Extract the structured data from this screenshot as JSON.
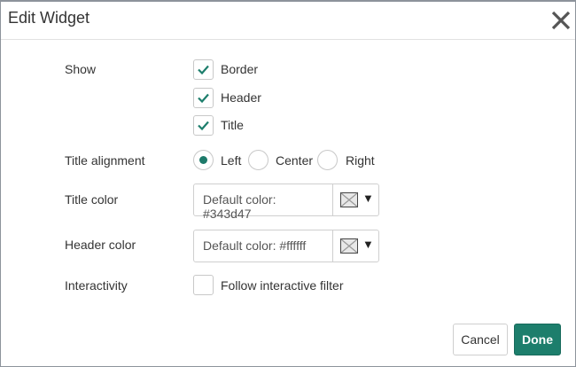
{
  "dialog": {
    "title": "Edit Widget",
    "close_icon": "close-icon"
  },
  "show": {
    "label": "Show",
    "options": [
      {
        "label": "Border",
        "checked": true
      },
      {
        "label": "Header",
        "checked": true
      },
      {
        "label": "Title",
        "checked": true
      }
    ]
  },
  "alignment": {
    "label": "Title alignment",
    "options": [
      {
        "label": "Left",
        "selected": true
      },
      {
        "label": "Center",
        "selected": false
      },
      {
        "label": "Right",
        "selected": false
      }
    ]
  },
  "title_color": {
    "label": "Title color",
    "placeholder": "Default color: #343d47"
  },
  "header_color": {
    "label": "Header color",
    "placeholder": "Default color: #ffffff"
  },
  "interactivity": {
    "label": "Interactivity",
    "option": "Follow interactive filter",
    "checked": false
  },
  "buttons": {
    "cancel": "Cancel",
    "done": "Done"
  },
  "colors": {
    "accent": "#1d7e6c"
  }
}
